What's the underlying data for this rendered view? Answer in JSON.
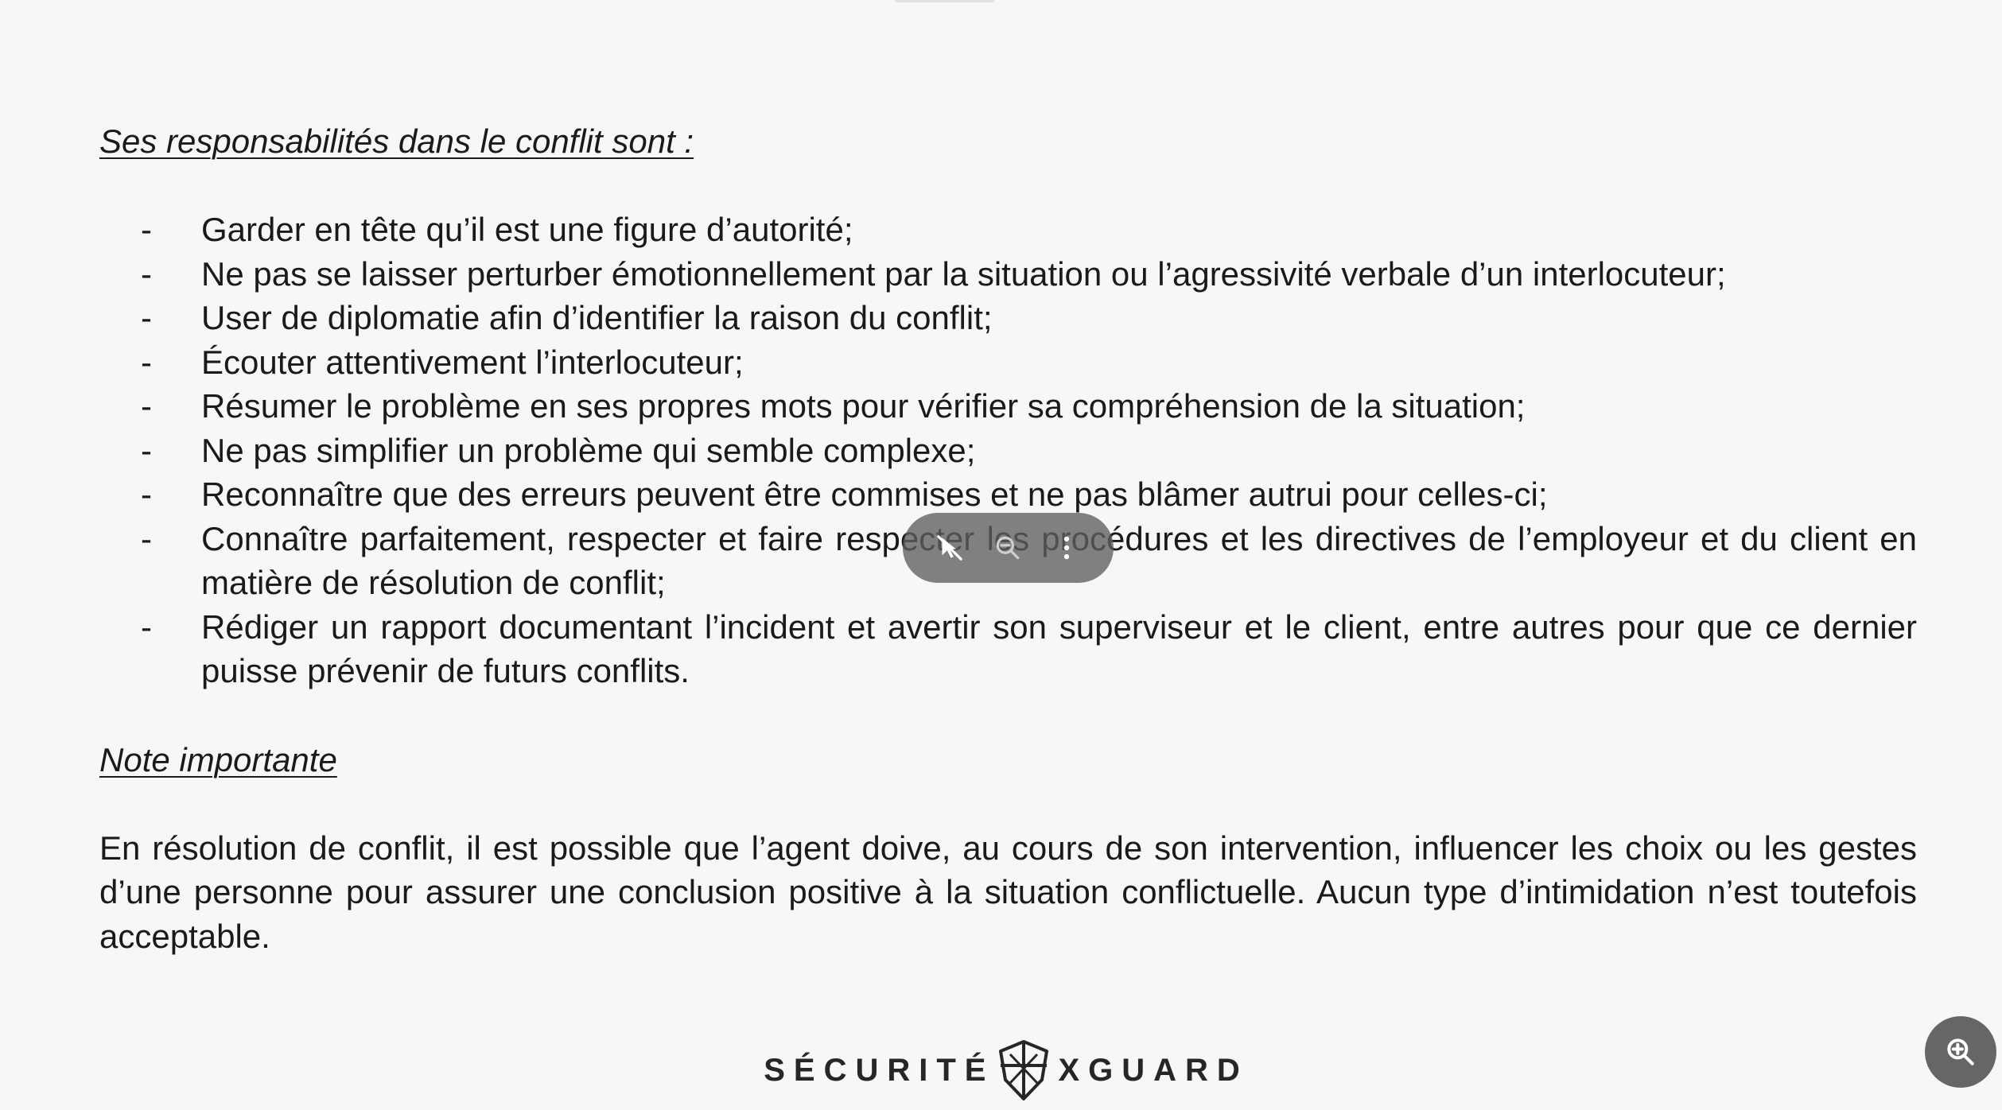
{
  "document": {
    "heading_responsibilities": "Ses responsabilités dans le conflit sont :",
    "bullet_marker": "-",
    "responsibilities": [
      "Garder en tête qu’il est une figure d’autorité;",
      "Ne pas se laisser perturber émotionnellement par la situation ou l’agressivité verbale d’un interlocuteur;",
      "User de diplomatie afin d’identifier la raison du conflit;",
      "Écouter attentivement l’interlocuteur;",
      "Résumer le problème en ses propres mots pour vérifier sa compréhension de la situation;",
      "Ne pas simplifier un problème qui semble complexe;",
      "Reconnaître que des erreurs peuvent être commises et ne pas blâmer autrui pour celles-ci;",
      "Connaître parfaitement, respecter et faire respecter les procédures et les directives de l’employeur et du client en matière de résolution de conflit;",
      "Rédiger un rapport documentant l’incident et avertir son superviseur et le client, entre autres pour que ce dernier puisse prévenir de futurs conflits."
    ],
    "heading_note": "Note importante",
    "note_text": "En résolution de conflit, il est possible que l’agent doive, au cours de son intervention, influencer les choix ou les gestes d’une personne pour assurer une conclusion positive à la situation conflictuelle. Aucun type d’intimidation n’est toutefois acceptable."
  },
  "footer": {
    "brand_left": "SÉCURITÉ",
    "brand_right": "XGUARD"
  },
  "toolbar": {
    "icons": [
      "pointer-off-icon",
      "zoom-out-icon",
      "more-vertical-icon"
    ]
  },
  "zoom_button": {
    "icon": "zoom-in-icon"
  },
  "colors": {
    "background": "#f7f7f7",
    "text": "#1a1a1a",
    "toolbar_bg": "#5f5f5f",
    "zoom_button_bg": "#666666"
  }
}
